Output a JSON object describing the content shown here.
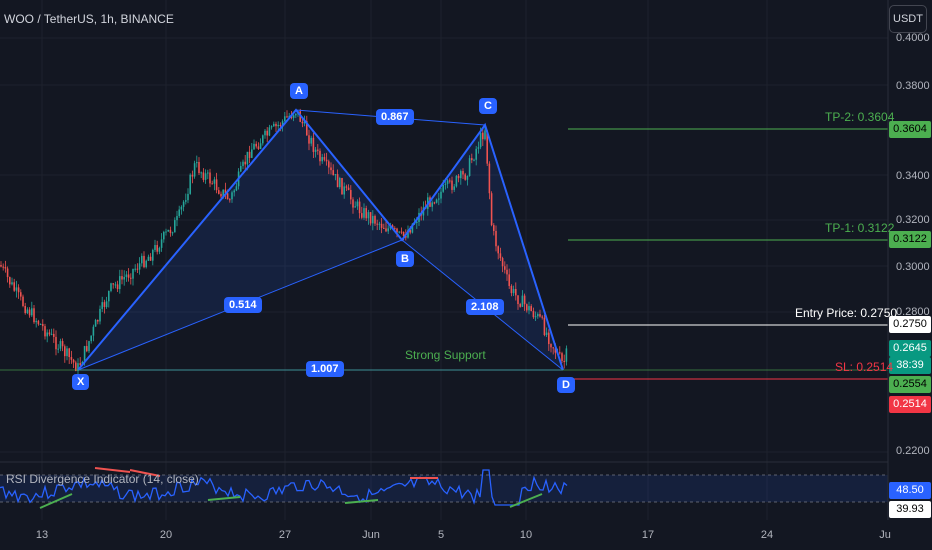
{
  "header": {
    "symbol_line": "WOO / TetherUS, 1h, BINANCE",
    "currency_button": "USDT"
  },
  "price_axis": {
    "ticks": [
      "0.4000",
      "0.3800",
      "0.3600",
      "0.3400",
      "0.3200",
      "0.3000",
      "0.2800",
      "0.2200"
    ],
    "tags": {
      "tp2": "0.3604",
      "tp1": "0.3122",
      "entry": "0.2750",
      "last": "0.2645",
      "countdown": "38:39",
      "support": "0.2554",
      "sl": "0.2514",
      "rsi_value": "48.50",
      "rsi_ma": "39.93"
    }
  },
  "time_axis": {
    "labels": [
      "13",
      "20",
      "27",
      "Jun",
      "5",
      "10",
      "17",
      "24",
      "Ju"
    ]
  },
  "levels": {
    "tp2": "TP-2: 0.3604",
    "tp1": "TP-1: 0.3122",
    "entry": "Entry Price: 0.2750",
    "sl": "SL: 0.2514",
    "support": "Strong Support"
  },
  "pattern": {
    "points": [
      "X",
      "A",
      "B",
      "C",
      "D"
    ],
    "ratios": {
      "xb": "0.514",
      "ac": "0.867",
      "bd": "2.108",
      "xd": "1.007"
    }
  },
  "indicator": {
    "title": "RSI Divergence Indicator (14, close)"
  },
  "colors": {
    "background": "#131722",
    "up": "#26a69a",
    "down": "#ef5350",
    "pattern": "#2962ff",
    "tp": "#4caf50",
    "sl": "#f23645",
    "rsi": "#2962ff"
  }
}
